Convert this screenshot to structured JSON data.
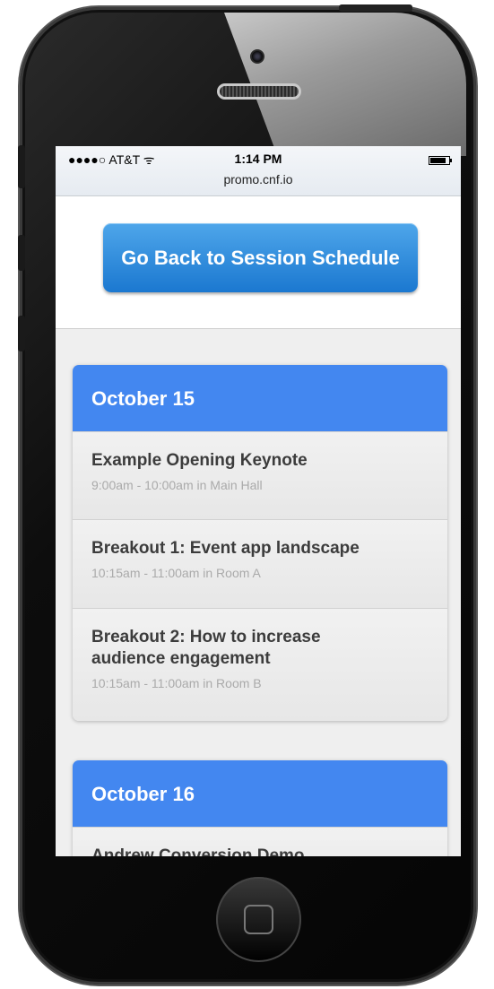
{
  "status_bar": {
    "carrier": "●●●●○ AT&T ᯤ",
    "time": "1:14 PM",
    "url": "promo.cnf.io",
    "battery_level": 0.85
  },
  "header": {
    "back_button_label": "Go Back to Session Schedule"
  },
  "days": [
    {
      "date": "October 15",
      "sessions": [
        {
          "title": "Example Opening Keynote",
          "meta": "9:00am - 10:00am in Main Hall"
        },
        {
          "title": "Breakout 1: Event app landscape",
          "meta": "10:15am - 11:00am in Room A"
        },
        {
          "title": "Breakout 2: How to increase audience engagement",
          "meta": "10:15am - 11:00am in Room B"
        }
      ]
    },
    {
      "date": "October 16",
      "sessions": [
        {
          "title": "Andrew Conversion Demo",
          "meta": ""
        }
      ]
    }
  ],
  "colors": {
    "accent_blue": "#4387f0",
    "button_blue": "#1b78d0"
  }
}
